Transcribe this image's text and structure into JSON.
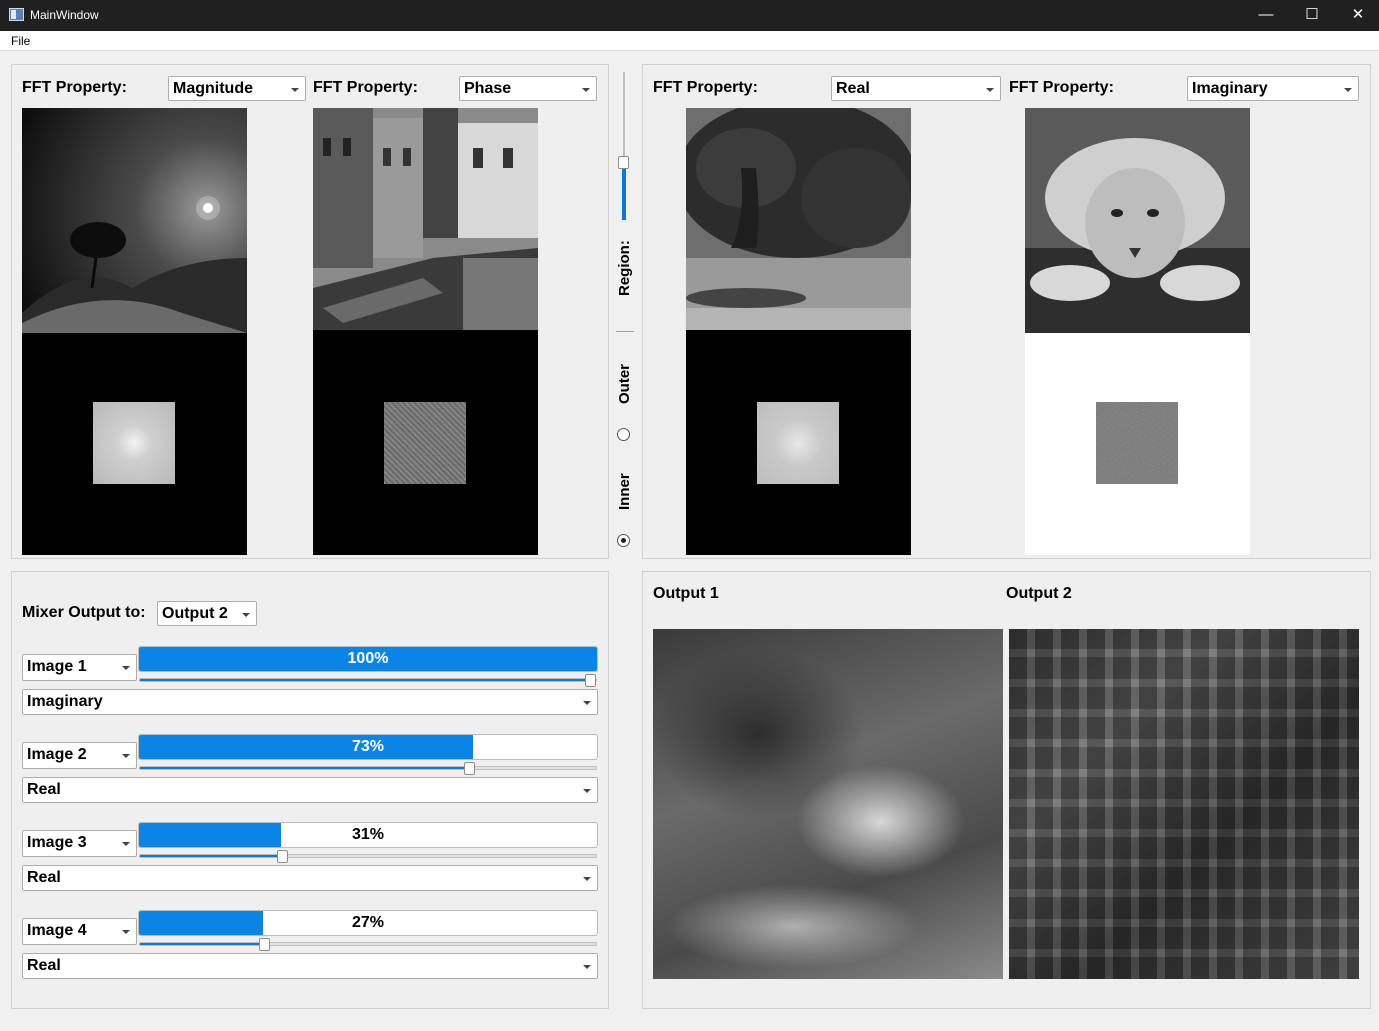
{
  "window": {
    "title": "MainWindow",
    "minimize": "—",
    "maximize": "☐",
    "close": "✕"
  },
  "menu": {
    "file": "File"
  },
  "viewers": [
    {
      "label": "FFT Property:",
      "property": "Magnitude"
    },
    {
      "label": "FFT Property:",
      "property": "Phase"
    },
    {
      "label": "FFT Property:",
      "property": "Real"
    },
    {
      "label": "FFT Property:",
      "property": "Imaginary"
    }
  ],
  "region": {
    "label": "Region:",
    "outer": "Outer",
    "inner": "Inner",
    "selected": "Inner",
    "slider_value": 0.38
  },
  "mixer": {
    "output_label": "Mixer Output to:",
    "output_value": "Output 2",
    "rows": [
      {
        "image": "Image 1",
        "weight": 100,
        "weight_text": "100%",
        "component": "Imaginary"
      },
      {
        "image": "Image 2",
        "weight": 73,
        "weight_text": "73%",
        "component": "Real"
      },
      {
        "image": "Image 3",
        "weight": 31,
        "weight_text": "31%",
        "component": "Real"
      },
      {
        "image": "Image 4",
        "weight": 27,
        "weight_text": "27%",
        "component": "Real"
      }
    ]
  },
  "outputs": {
    "output1": "Output 1",
    "output2": "Output 2"
  }
}
